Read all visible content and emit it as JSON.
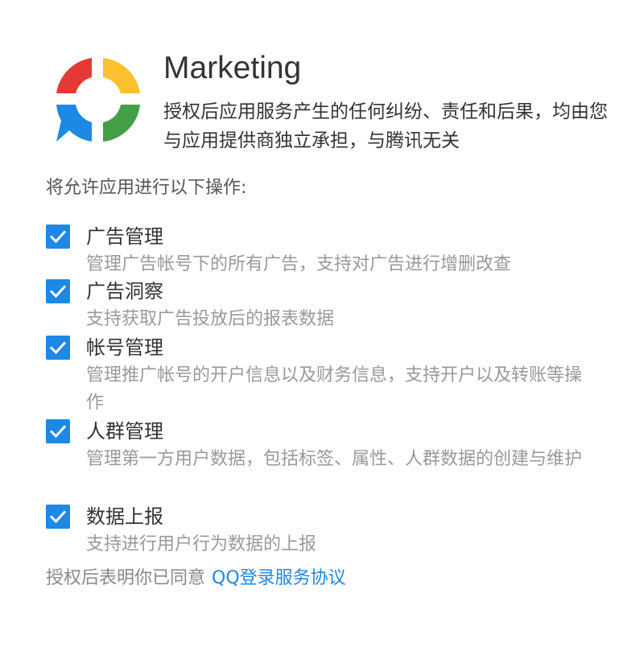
{
  "app": {
    "logo_icon": "chat-ring-logo-icon",
    "title": "Marketing",
    "disclaimer": "授权后应用服务产生的任何纠纷、责任和后果，均由您与应用提供商独立承担，与腾讯无关"
  },
  "permissions_label": "将允许应用进行以下操作:",
  "permissions": [
    {
      "title": "广告管理",
      "desc": "管理广告帐号下的所有广告，支持对广告进行增删改查",
      "checked": true
    },
    {
      "title": "广告洞察",
      "desc": "支持获取广告投放后的报表数据",
      "checked": true
    },
    {
      "title": "帐号管理",
      "desc": "管理推广帐号的开户信息以及财务信息，支持开户以及转账等操作",
      "checked": true
    },
    {
      "title": "人群管理",
      "desc": "管理第一方用户数据，包括标签、属性、人群数据的创建与维护",
      "checked": true
    },
    {
      "title": "数据上报",
      "desc": "支持进行用户行为数据的上报",
      "checked": true
    }
  ],
  "footer": {
    "text": "授权后表明你已同意",
    "link_label": "QQ登录服务协议"
  },
  "colors": {
    "accent": "#1e88e5",
    "logo_red": "#e53935",
    "logo_yellow": "#fbc02d",
    "logo_green": "#43a047",
    "logo_blue": "#1e88e5"
  }
}
